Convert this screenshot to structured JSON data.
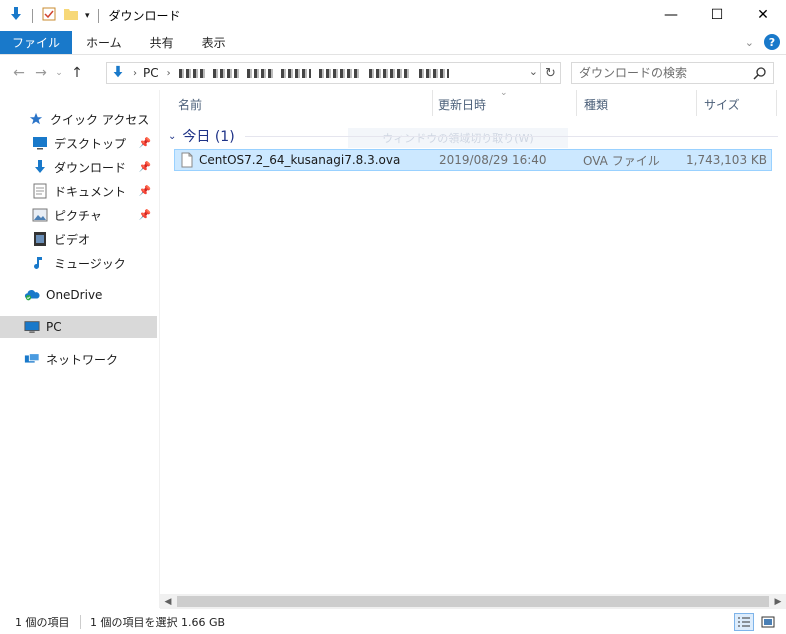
{
  "window": {
    "title": "ダウンロード",
    "controls": {
      "minimize": "—",
      "maximize": "☐",
      "close": "✕"
    }
  },
  "ribbon": {
    "tabs": [
      {
        "label": "ファイル",
        "active": true
      },
      {
        "label": "ホーム"
      },
      {
        "label": "共有"
      },
      {
        "label": "表示"
      }
    ],
    "help": "?"
  },
  "address_bar": {
    "root": "PC",
    "search_placeholder": "ダウンロードの検索"
  },
  "sidebar": {
    "quick_access": "クイック アクセス",
    "items": [
      {
        "label": "デスクトップ",
        "icon": "desktop-icon",
        "pinned": true
      },
      {
        "label": "ダウンロード",
        "icon": "download-icon",
        "pinned": true
      },
      {
        "label": "ドキュメント",
        "icon": "document-icon",
        "pinned": true
      },
      {
        "label": "ピクチャ",
        "icon": "picture-icon",
        "pinned": true
      },
      {
        "label": "ビデオ",
        "icon": "video-icon"
      },
      {
        "label": "ミュージック",
        "icon": "music-icon"
      }
    ],
    "onedrive": "OneDrive",
    "pc": "PC",
    "network": "ネットワーク"
  },
  "columns": {
    "name": "名前",
    "date": "更新日時",
    "type": "種類",
    "size": "サイズ"
  },
  "group": {
    "label": "今日 (1)"
  },
  "ghost_tooltip": "ウィンドウの領域切り取り(W)",
  "files": [
    {
      "name": "CentOS7.2_64_kusanagi7.8.3.ova",
      "date": "2019/08/29 16:40",
      "type": "OVA ファイル",
      "size": "1,743,103 KB",
      "selected": true
    }
  ],
  "status": {
    "item_count": "1 個の項目",
    "selection": "1 個の項目を選択  1.66 GB"
  },
  "colors": {
    "accent": "#1979ca",
    "selection_bg": "#cce8ff",
    "selection_border": "#99d1ff",
    "group_text": "#1e3287"
  }
}
